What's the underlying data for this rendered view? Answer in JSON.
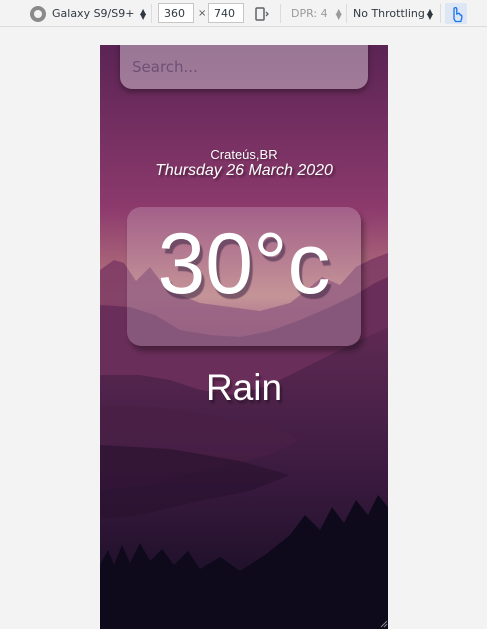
{
  "devtools_toolbar": {
    "device_name": "Galaxy S9/S9+",
    "width": "360",
    "times": "×",
    "height": "740",
    "dpr": "DPR: 4",
    "throttling": "No Throttling",
    "icons": [
      "device-chrome-icon",
      "dropdown-arrows-icon",
      "rotate-icon",
      "touch-icon"
    ]
  },
  "weather_app": {
    "search": {
      "placeholder": "Search..."
    },
    "location": "Crateús,BR",
    "date": "Thursday 26 March 2020",
    "temperature": "30°c",
    "condition": "Rain",
    "colors": {
      "sky_top": "#5a2454",
      "sky_mid": "#8d3a6d",
      "horizon": "#b77a7e",
      "mountain_far": "#7d3a64",
      "mountain_mid": "#5f2a54",
      "valley_dark": "#2b1330",
      "forest": "#0e0a1c"
    }
  }
}
